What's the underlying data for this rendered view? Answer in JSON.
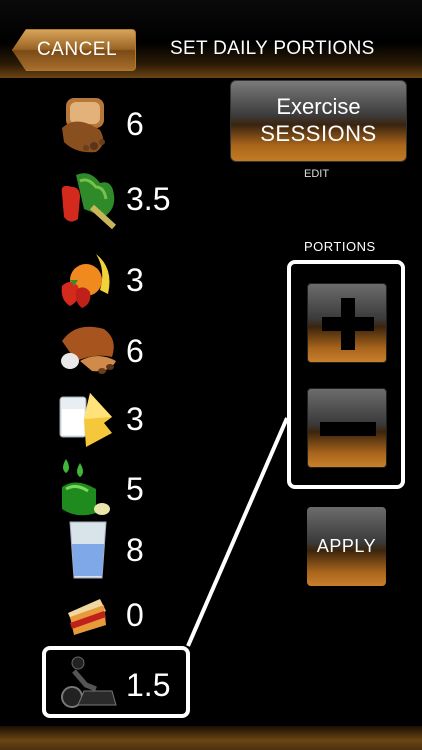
{
  "header": {
    "cancel_label": "CANCEL",
    "title": "SET DAILY PORTIONS"
  },
  "portions": [
    {
      "icon": "bread-grains-icon",
      "value": "6"
    },
    {
      "icon": "vegetables-icon",
      "value": "3.5"
    },
    {
      "icon": "fruits-icon",
      "value": "3"
    },
    {
      "icon": "meat-beans-icon",
      "value": "6"
    },
    {
      "icon": "milk-cheese-icon",
      "value": "3"
    },
    {
      "icon": "oils-icon",
      "value": "5"
    },
    {
      "icon": "water-glass-icon",
      "value": "8"
    },
    {
      "icon": "cake-dessert-icon",
      "value": "0"
    },
    {
      "icon": "exercise-bike-icon",
      "value": "1.5"
    }
  ],
  "exercise": {
    "line1": "Exercise",
    "line2": "SESSIONS",
    "edit_label": "EDIT"
  },
  "controls": {
    "portions_label": "PORTIONS",
    "apply_label": "APPLY"
  }
}
